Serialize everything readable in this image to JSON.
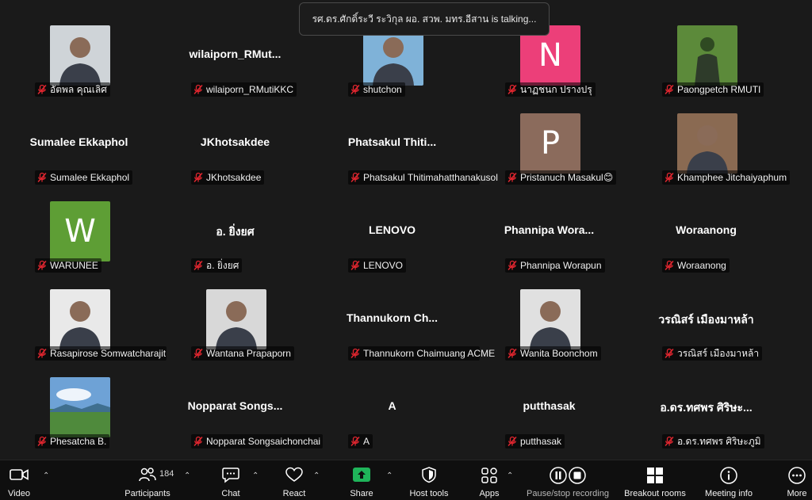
{
  "banner": {
    "text": "รศ.ดร.ศักดิ์ระวี ระวิกุล ผอ. สวพ. มทร.อีสาน is talking..."
  },
  "participants": [
    {
      "label": "อัตพล คุณเลิศ",
      "display": "",
      "avatar": "photo",
      "letter": "",
      "color": "#cfd4d8"
    },
    {
      "label": "wilaiporn_RMutiKKC",
      "display": "wilaiporn_RMut...",
      "avatar": "none",
      "letter": "",
      "color": ""
    },
    {
      "label": "shutchon",
      "display": "",
      "avatar": "photo",
      "letter": "",
      "color": "#7fb2d8"
    },
    {
      "label": "นาฏชนก ปรางปรุ",
      "display": "",
      "avatar": "letter",
      "letter": "N",
      "color": "#ec3f79"
    },
    {
      "label": "Paongpetch RMUTI",
      "display": "",
      "avatar": "photo",
      "letter": "",
      "color": "#5c8a3a"
    },
    {
      "label": "Sumalee Ekkaphol",
      "display": "Sumalee Ekkaphol",
      "avatar": "none",
      "letter": "",
      "color": ""
    },
    {
      "label": "JKhotsakdee",
      "display": "JKhotsakdee",
      "avatar": "none",
      "letter": "",
      "color": ""
    },
    {
      "label": "Phatsakul Thitimahatthanakusol",
      "display": "Phatsakul Thiti...",
      "avatar": "none",
      "letter": "",
      "color": ""
    },
    {
      "label": "Pristanuch Masakul😊",
      "display": "",
      "avatar": "letter",
      "letter": "P",
      "color": "#8b6b5c"
    },
    {
      "label": "Khamphee Jitchaiyaphum",
      "display": "",
      "avatar": "photo",
      "letter": "",
      "color": "#8a6a52"
    },
    {
      "label": "WARUNEE",
      "display": "",
      "avatar": "letter",
      "letter": "W",
      "color": "#5e9e35"
    },
    {
      "label": "อ. ยิ่งยศ",
      "display": "อ. ยิ่งยศ",
      "avatar": "none",
      "letter": "",
      "color": ""
    },
    {
      "label": "LENOVO",
      "display": "LENOVO",
      "avatar": "none",
      "letter": "",
      "color": ""
    },
    {
      "label": "Phannipa Worapun",
      "display": "Phannipa Wora...",
      "avatar": "none",
      "letter": "",
      "color": ""
    },
    {
      "label": "Woraanong",
      "display": "Woraanong",
      "avatar": "none",
      "letter": "",
      "color": ""
    },
    {
      "label": "Rasapirose Somwatcharajit",
      "display": "",
      "avatar": "photo",
      "letter": "",
      "color": "#e9e9e9"
    },
    {
      "label": "Wantana Prapaporn",
      "display": "",
      "avatar": "photo",
      "letter": "",
      "color": "#d8d8d8"
    },
    {
      "label": "Thannukorn Chaimuang ACME",
      "display": "Thannukorn Ch...",
      "avatar": "none",
      "letter": "",
      "color": ""
    },
    {
      "label": "Wanita Boonchom",
      "display": "",
      "avatar": "photo",
      "letter": "",
      "color": "#e0e0e0"
    },
    {
      "label": "วรณิสร์ เมืองมาหล้า",
      "display": "วรณิสร์ เมืองมาหล้า",
      "avatar": "none",
      "letter": "",
      "color": ""
    },
    {
      "label": "Phesatcha B.",
      "display": "",
      "avatar": "photo",
      "letter": "",
      "color": "#6ea2d6"
    },
    {
      "label": "Nopparat Songsaichonchai",
      "display": "Nopparat Songs...",
      "avatar": "none",
      "letter": "",
      "color": ""
    },
    {
      "label": "A",
      "display": "A",
      "avatar": "none",
      "letter": "",
      "color": ""
    },
    {
      "label": "putthasak",
      "display": "putthasak",
      "avatar": "none",
      "letter": "",
      "color": ""
    },
    {
      "label": "อ.ดร.ทศพร ศิริษะภูมิ",
      "display": "อ.ดร.ทศพร ศิริษะ...",
      "avatar": "none",
      "letter": "",
      "color": ""
    }
  ],
  "toolbar": {
    "video": "Video",
    "participants": "Participants",
    "participant_count": "184",
    "chat": "Chat",
    "react": "React",
    "share": "Share",
    "host_tools": "Host tools",
    "apps": "Apps",
    "recording": "Pause/stop recording",
    "breakout": "Breakout rooms",
    "meeting_info": "Meeting info",
    "more": "More"
  },
  "colors": {
    "share_green": "#1fb45a",
    "mic_off_red": "#e0262f",
    "background": "#1a1a1a"
  }
}
